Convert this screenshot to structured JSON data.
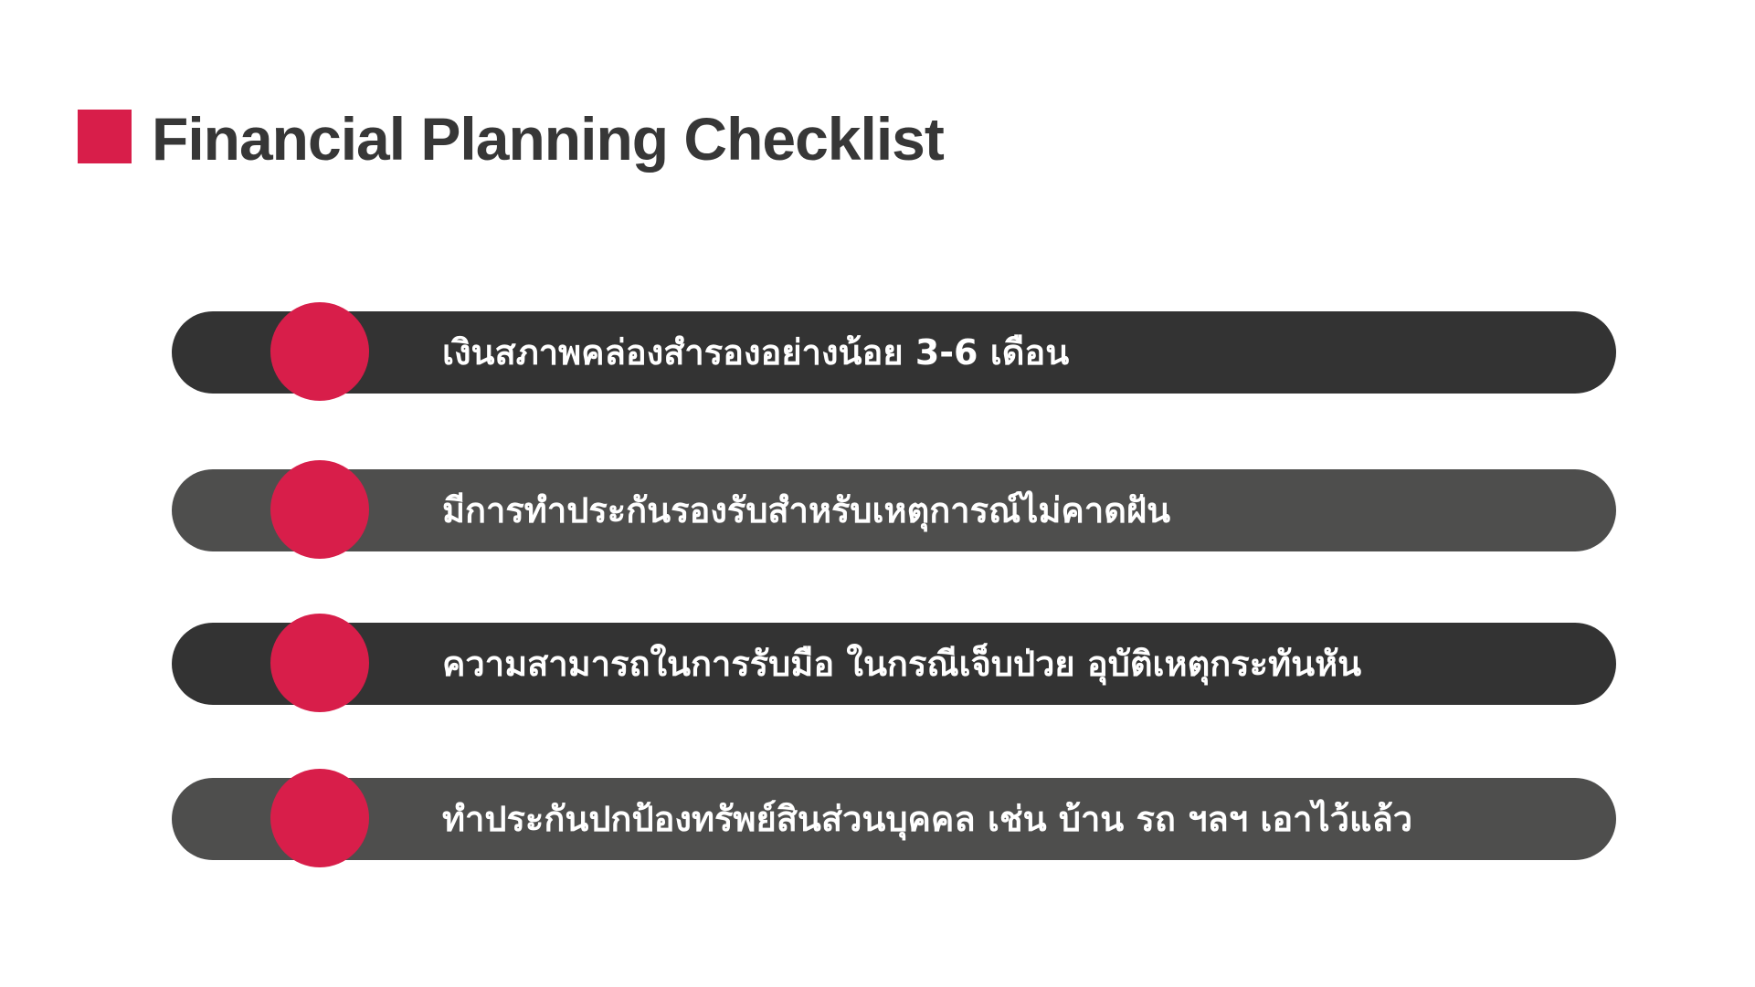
{
  "slide": {
    "title": "Financial Planning Checklist",
    "accent_color": "#d81e4a",
    "title_color": "#373737"
  },
  "checklist": {
    "items": [
      {
        "label": "เงินสภาพคล่องสำรองอย่างน้อย 3-6 เดือน",
        "shade": "dark"
      },
      {
        "label": "มีการทำประกันรองรับสำหรับเหตุการณ์ไม่คาดฝัน",
        "shade": "light"
      },
      {
        "label": "ความสามารถในการรับมือ ในกรณีเจ็บป่วย อุบัติเหตุกระทันหัน",
        "shade": "dark"
      },
      {
        "label": "ทำประกันปกป้องทรัพย์สินส่วนบุคคล เช่น บ้าน รถ ฯลฯ เอาไว้แล้ว",
        "shade": "light"
      }
    ],
    "colors": {
      "dark": "#333333",
      "light": "#4e4e4d",
      "bullet": "#d81e4a",
      "text": "#ffffff"
    }
  }
}
